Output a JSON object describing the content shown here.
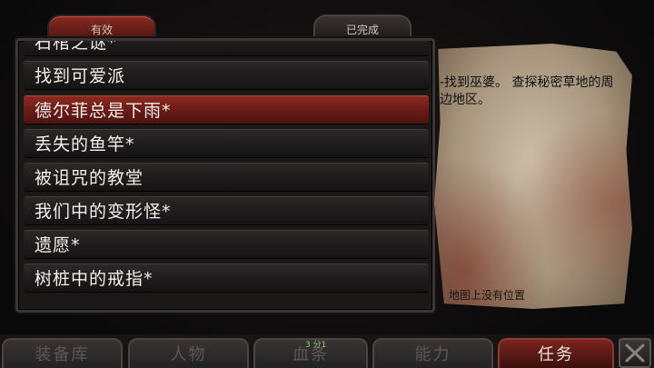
{
  "tabs": {
    "active": "有效",
    "completed": "已完成"
  },
  "quest_list": [
    {
      "label": "石棺之谜*",
      "selected": false
    },
    {
      "label": "找到可爱派",
      "selected": false
    },
    {
      "label": "德尔菲总是下雨*",
      "selected": true
    },
    {
      "label": "丢失的鱼竿*",
      "selected": false
    },
    {
      "label": "被诅咒的教堂",
      "selected": false
    },
    {
      "label": "我们中的变形怪*",
      "selected": false
    },
    {
      "label": "遗愿*",
      "selected": false
    },
    {
      "label": "树桩中的戒指*",
      "selected": false
    }
  ],
  "detail": {
    "description": "-找到巫婆。 查探秘密草地的周边地区。",
    "location_note": "地图上没有位置"
  },
  "nav": {
    "inventory": "装备库",
    "character": "人物",
    "bloodline": "血条",
    "bloodline_badge": "3 分1",
    "abilities": "能力",
    "quests": "任务"
  },
  "colors": {
    "selected_row": "#7a241e",
    "parchment": "#bfae96",
    "badge": "#7fd46a"
  }
}
